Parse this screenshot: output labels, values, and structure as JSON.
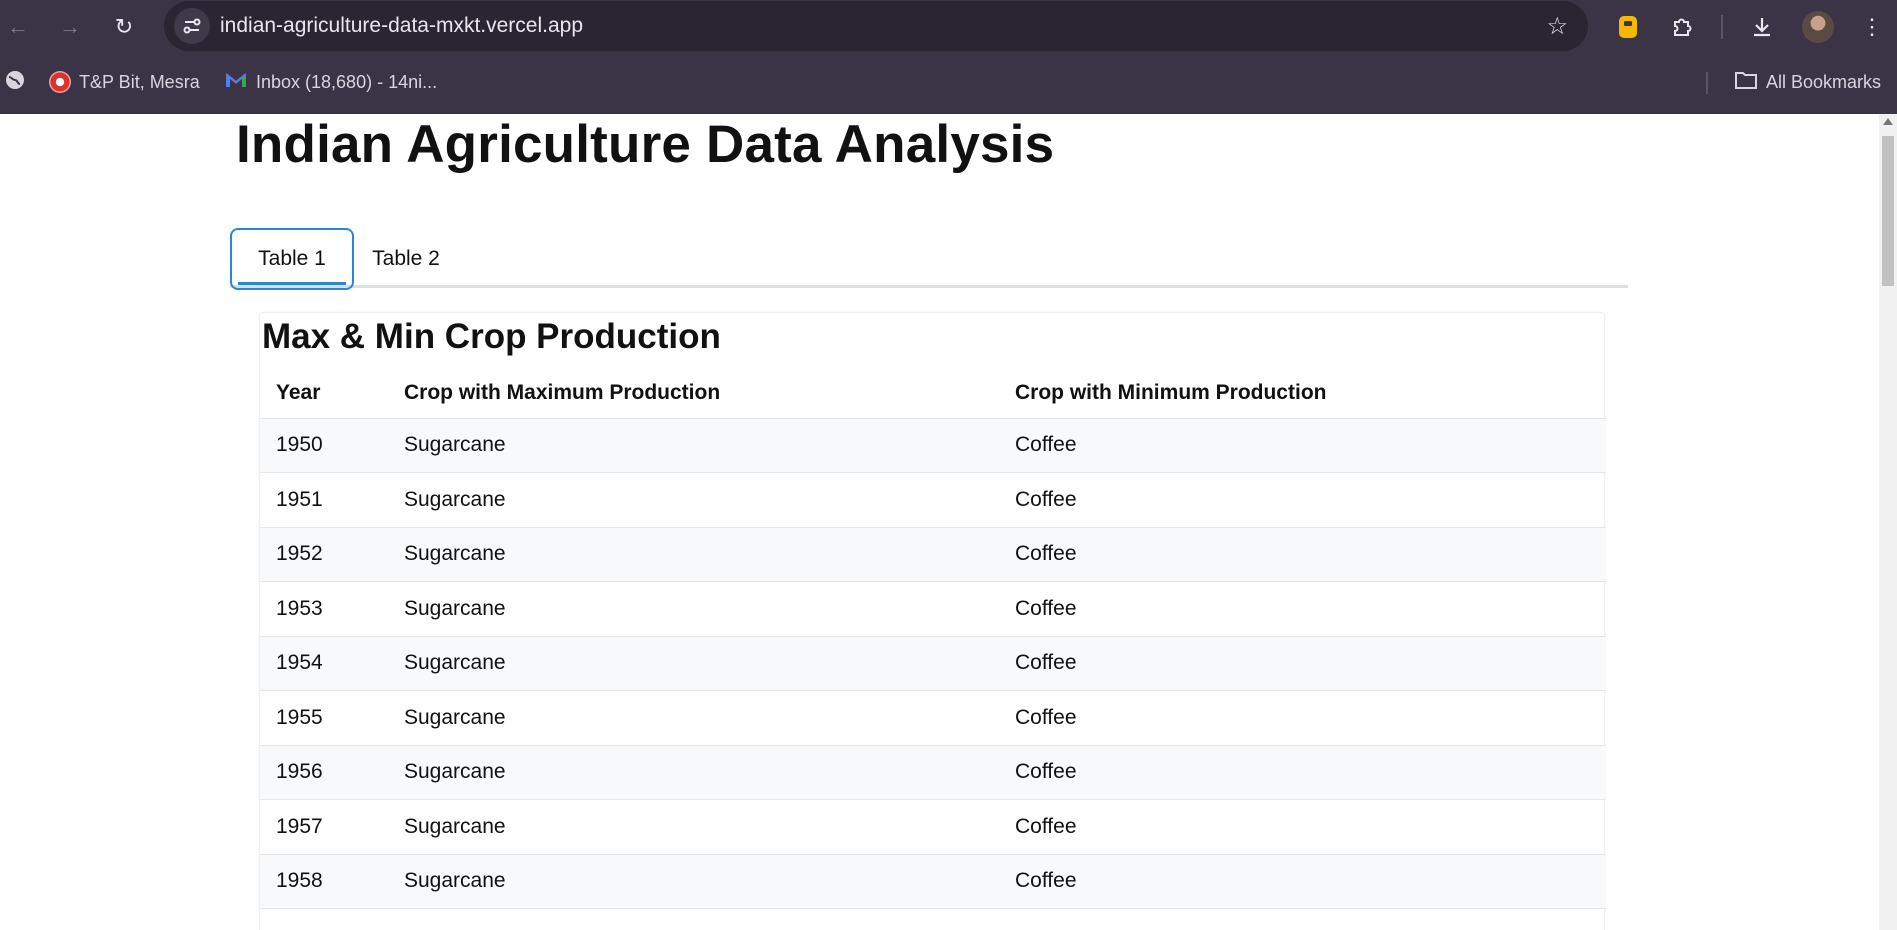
{
  "browser": {
    "url": "indian-agriculture-data-mxkt.vercel.app",
    "bookmarks": [
      {
        "label": "T&P Bit, Mesra"
      },
      {
        "label": "Inbox (18,680) - 14ni..."
      }
    ],
    "all_bookmarks_label": "All Bookmarks"
  },
  "page": {
    "title": "Indian Agriculture Data Analysis",
    "tabs": [
      {
        "label": "Table 1",
        "active": true
      },
      {
        "label": "Table 2",
        "active": false
      }
    ],
    "section_title": "Max & Min Crop Production",
    "table": {
      "headers": [
        "Year",
        "Crop with Maximum Production",
        "Crop with Minimum Production"
      ],
      "rows": [
        {
          "year": "1950",
          "max": "Sugarcane",
          "min": "Coffee"
        },
        {
          "year": "1951",
          "max": "Sugarcane",
          "min": "Coffee"
        },
        {
          "year": "1952",
          "max": "Sugarcane",
          "min": "Coffee"
        },
        {
          "year": "1953",
          "max": "Sugarcane",
          "min": "Coffee"
        },
        {
          "year": "1954",
          "max": "Sugarcane",
          "min": "Coffee"
        },
        {
          "year": "1955",
          "max": "Sugarcane",
          "min": "Coffee"
        },
        {
          "year": "1956",
          "max": "Sugarcane",
          "min": "Coffee"
        },
        {
          "year": "1957",
          "max": "Sugarcane",
          "min": "Coffee"
        },
        {
          "year": "1958",
          "max": "Sugarcane",
          "min": "Coffee"
        }
      ]
    }
  },
  "colors": {
    "accent": "#2a86d6",
    "chrome_bg": "#3a3446",
    "row_alt": "#f8f9fa"
  }
}
